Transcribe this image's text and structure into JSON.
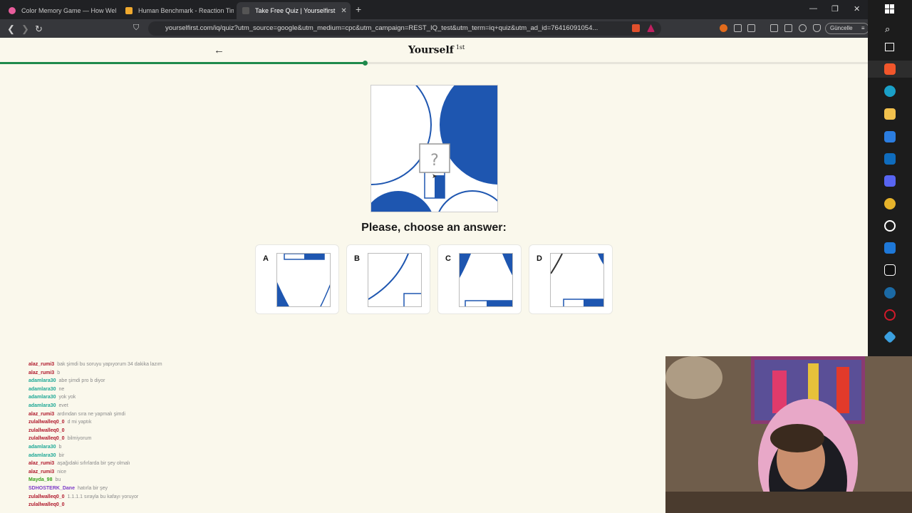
{
  "browser": {
    "tabs": [
      {
        "title": "Color Memory Game — How Well Ca",
        "active": false,
        "color": "#e85d9c"
      },
      {
        "title": "Human Benchmark - Reaction Time",
        "active": false,
        "color": "#f0a92e"
      },
      {
        "title": "Take Free Quiz | Yourselfirst",
        "active": true,
        "color": "#555555"
      }
    ],
    "url": "yourselfirst.com/iq/quiz?utm_source=google&utm_medium=cpc&utm_campaign=REST_IQ_test&utm_term=iq+quiz&utm_ad_id=76416091054...",
    "update_label": "Güncelle"
  },
  "site": {
    "logo": "Yourself",
    "logo_sup": "1st",
    "progress": 0.42,
    "accent": "#1f8a4c",
    "shape_color": "#1e56b0"
  },
  "quiz": {
    "question_mark": "?",
    "prompt": "Please, choose an answer:",
    "options": [
      {
        "letter": "A"
      },
      {
        "letter": "B"
      },
      {
        "letter": "C"
      },
      {
        "letter": "D"
      }
    ]
  },
  "chat": [
    {
      "user": "alaz_rumi3",
      "msg": "bak şimdi bu soruyu yapıyorum 34 dakika lazım",
      "color": "#b0182b"
    },
    {
      "user": "alaz_rumi3",
      "msg": "b",
      "color": "#b0182b"
    },
    {
      "user": "adamlara30",
      "msg": "abe şimdi pro b diyor",
      "color": "#1ea896"
    },
    {
      "user": "adamlara30",
      "msg": "ne",
      "color": "#1ea896"
    },
    {
      "user": "adamlara30",
      "msg": "yok yok",
      "color": "#1ea896"
    },
    {
      "user": "adamlara30",
      "msg": "evet",
      "color": "#1ea896"
    },
    {
      "user": "alaz_rumi3",
      "msg": "ardından sıra ne yapmalı şimdi",
      "color": "#b0182b"
    },
    {
      "user": "zulallwalleq0_0",
      "msg": "d mi yaptık",
      "color": "#b0182b"
    },
    {
      "user": "zulallwalleq0_0",
      "msg": "",
      "color": "#b0182b"
    },
    {
      "user": "zulallwalleq0_0",
      "msg": "bilmiyorum",
      "color": "#b0182b"
    },
    {
      "user": "adamlara30",
      "msg": "b",
      "color": "#1ea896"
    },
    {
      "user": "adamlara30",
      "msg": "bir",
      "color": "#1ea896"
    },
    {
      "user": "alaz_rumi3",
      "msg": "aşağıdaki sıfırlarda bir şey olmalı",
      "color": "#b0182b"
    },
    {
      "user": "alaz_rumi3",
      "msg": "nice",
      "color": "#b0182b"
    },
    {
      "user": "Mayda_98",
      "msg": "bu",
      "color": "#3aa01e"
    },
    {
      "user": "SDHOSTERK_Dane",
      "msg": "hatırla bir şey",
      "color": "#7d3cc8"
    },
    {
      "user": "zulallwalleq0_0",
      "msg": "1.1.1.1 sırayla bu kafayı yoruyor",
      "color": "#b0182b"
    },
    {
      "user": "zulallwalleq0_0",
      "msg": "",
      "color": "#b0182b"
    }
  ]
}
